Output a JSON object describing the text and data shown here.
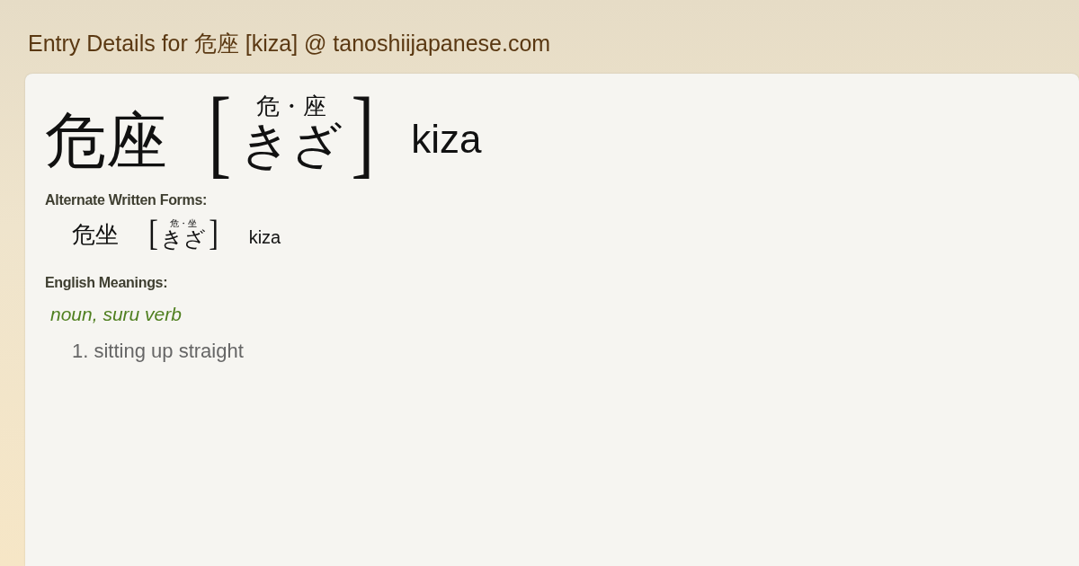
{
  "page_title": "Entry Details for 危座 [kiza] @ tanoshiijapanese.com",
  "entry": {
    "kanji": "危座",
    "bracket_open": "[",
    "furigana": "危・座",
    "kana": "きざ",
    "bracket_close": "]",
    "romaji": "kiza"
  },
  "alternate_forms": {
    "heading": "Alternate Written Forms:",
    "forms": [
      {
        "kanji": "危坐",
        "bracket_open": "[",
        "furigana": "危・坐",
        "kana": "きざ",
        "bracket_close": "]",
        "romaji": "kiza"
      }
    ]
  },
  "meanings": {
    "heading": "English Meanings:",
    "part_of_speech": "noun, suru verb",
    "senses": [
      {
        "number": "1.",
        "text": "sitting up straight"
      }
    ]
  }
}
